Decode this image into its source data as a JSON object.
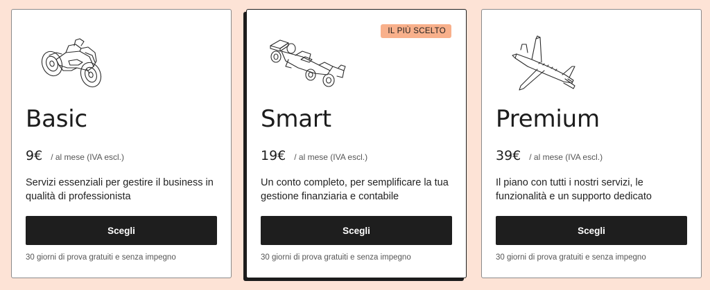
{
  "plans": [
    {
      "name": "Basic",
      "illustration": "motorcycle-icon",
      "price": "9€",
      "price_note": "/ al mese (IVA escl.)",
      "description": "Servizi essenziali per gestire il business in qualità di professionista",
      "button_label": "Scegli",
      "trial_note": "30 giorni di prova gratuiti e senza impegno"
    },
    {
      "name": "Smart",
      "illustration": "race-car-icon",
      "badge": "IL PIÙ SCELTO",
      "price": "19€",
      "price_note": "/ al mese (IVA escl.)",
      "description": "Un conto completo, per semplificare la tua gestione finanziaria e contabile",
      "button_label": "Scegli",
      "trial_note": "30 giorni di prova gratuiti e senza impegno"
    },
    {
      "name": "Premium",
      "illustration": "airplane-icon",
      "price": "39€",
      "price_note": "/ al mese (IVA escl.)",
      "description": "Il piano con tutti i nostri servizi, le funzionalità e un supporto dedicato",
      "button_label": "Scegli",
      "trial_note": "30 giorni di prova gratuiti e senza impegno"
    }
  ],
  "colors": {
    "background": "#fde3d6",
    "card": "#ffffff",
    "button": "#1e1e1e",
    "badge": "#f8b08b"
  }
}
